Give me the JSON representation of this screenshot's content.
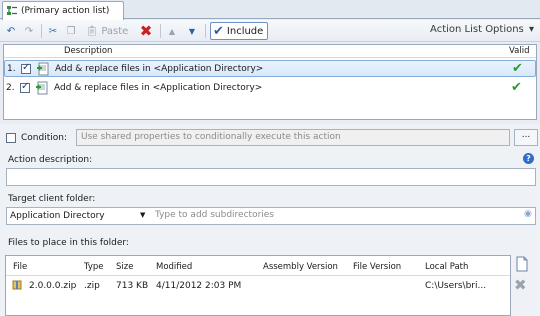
{
  "tab": {
    "label": "(Primary action list)"
  },
  "toolbar": {
    "paste_label": "Paste",
    "include_label": "Include",
    "options_label": "Action List Options",
    "options_arrow": "▾"
  },
  "grid": {
    "col_description": "Description",
    "col_valid": "Valid",
    "rows": [
      {
        "num": "1.",
        "description": "Add & replace files in <Application Directory>"
      },
      {
        "num": "2.",
        "description": "Add & replace files in <Application Directory>"
      }
    ]
  },
  "condition": {
    "label": "Condition:",
    "placeholder": "Use shared properties to conditionally execute this action",
    "browse": "..."
  },
  "action_description": {
    "label": "Action description:"
  },
  "target": {
    "label": "Target client folder:",
    "selected": "Application Directory",
    "subdir_placeholder": "Type to add subdirectories"
  },
  "files": {
    "label": "Files to place in this folder:",
    "headers": [
      "File",
      "Type",
      "Size",
      "Modified",
      "Assembly Version",
      "File Version",
      "Local Path"
    ],
    "rows": [
      {
        "file": "2.0.0.0.zip",
        "type": ".zip",
        "size": "713 KB",
        "modified": "4/11/2012 2:03 PM",
        "assembly": "",
        "version": "",
        "path": "C:\\Users\\bri..."
      }
    ]
  },
  "colors": {
    "accent": "#2f6fc9",
    "valid": "#2e9a2e",
    "delete": "#cc1f1f"
  }
}
